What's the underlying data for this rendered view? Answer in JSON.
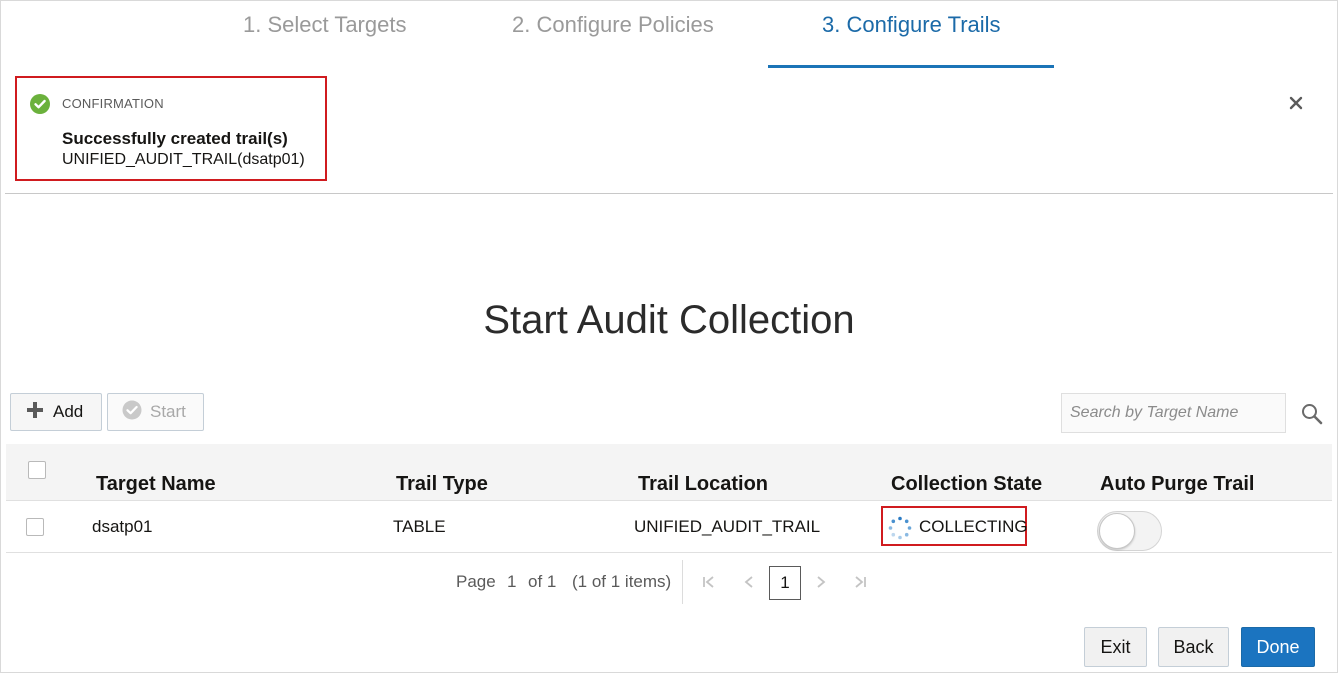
{
  "wizard": {
    "steps": [
      {
        "label": "1. Select Targets",
        "state": "inactive"
      },
      {
        "label": "2. Configure Policies",
        "state": "inactive"
      },
      {
        "label": "3. Configure Trails",
        "state": "active"
      }
    ]
  },
  "confirmation": {
    "label": "CONFIRMATION",
    "title": "Successfully created trail(s)",
    "detail": "UNIFIED_AUDIT_TRAIL(dsatp01)",
    "icon": "check-circle-icon",
    "close_icon": "close-icon"
  },
  "page": {
    "title": "Start Audit Collection"
  },
  "toolbar": {
    "add_label": "Add",
    "start_label": "Start",
    "search_placeholder": "Search by Target Name"
  },
  "table": {
    "columns": [
      "Target Name",
      "Trail Type",
      "Trail Location",
      "Collection State",
      "Auto Purge Trail"
    ],
    "rows": [
      {
        "target_name": "dsatp01",
        "trail_type": "TABLE",
        "trail_location": "UNIFIED_AUDIT_TRAIL",
        "collection_state": "COLLECTING",
        "auto_purge": false
      }
    ]
  },
  "pagination": {
    "page_label": "Page",
    "page_number": "1",
    "of_label": "of 1",
    "items_label": "(1 of 1 items)",
    "current": "1"
  },
  "footer": {
    "exit_label": "Exit",
    "back_label": "Back",
    "done_label": "Done"
  },
  "colors": {
    "accent": "#1b74c0",
    "success": "#6bb13c",
    "highlight_border": "#d01b1f"
  }
}
